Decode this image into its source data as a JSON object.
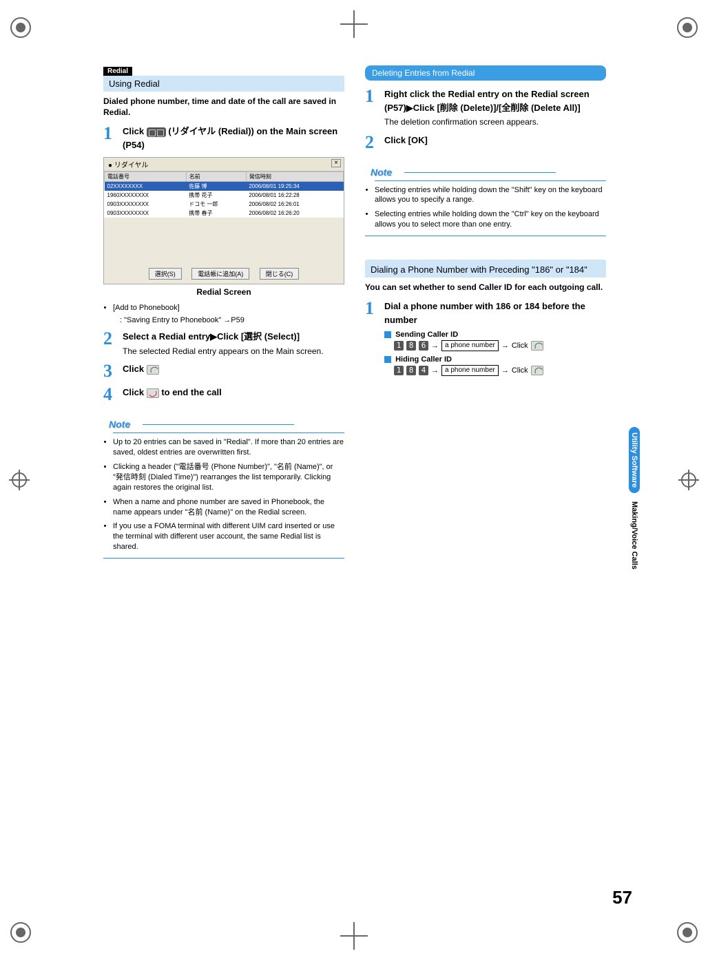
{
  "page_number": "57",
  "side_tab": {
    "blue": "Utility Software",
    "black": "Making/Voice Calls"
  },
  "left": {
    "tag": "Redial",
    "heading": "Using Redial",
    "intro": "Dialed phone number, time and date of the call are saved in Redial.",
    "step1": {
      "pre": "Click ",
      "post": " (リダイヤル (Redial)) on the Main screen (P54)"
    },
    "screenshot": {
      "title": "リダイヤル",
      "headers": [
        "電話番号",
        "名前",
        "発信時刻"
      ],
      "rows": [
        [
          "02XXXXXXXX",
          "佐藤 博",
          "2006/08/01 19:25:34"
        ],
        [
          "1960XXXXXXXX",
          "携帯 花子",
          "2006/08/01 16:22:28"
        ],
        [
          "0903XXXXXXXX",
          "ドコモ 一郎",
          "2006/08/02 16:26:01"
        ],
        [
          "0903XXXXXXXX",
          "携帯 春子",
          "2006/08/02 16:26:20"
        ]
      ],
      "buttons": [
        "選択(S)",
        "電話帳に追加(A)",
        "閉じる(C)"
      ]
    },
    "caption": "Redial Screen",
    "add_label": "[Add to Phonebook]",
    "add_ref": ":   \"Saving Entry to Phonebook\" →P59",
    "step2": {
      "title": "Select a Redial entry▶Click [選択 (Select)]",
      "desc": "The selected Redial entry appears on the Main screen."
    },
    "step3": {
      "pre": "Click "
    },
    "step4": {
      "pre": "Click ",
      "post": " to end the call"
    },
    "note_label": "Note",
    "notes": [
      "Up to 20 entries can be saved in \"Redial\". If more than 20 entries are saved, oldest entries are overwritten first.",
      "Clicking a header (\"電話番号 (Phone Number)\", \"名前 (Name)\", or \"発信時刻 (Dialed Time)\") rearranges the list temporarily. Clicking again restores the original list.",
      "When a name and phone number are saved in Phonebook, the name appears under \"名前 (Name)\" on the Redial screen.",
      "If you use a FOMA terminal with different UIM card inserted or use the terminal with different user account, the same Redial list is shared."
    ]
  },
  "right": {
    "subheading1": "Deleting Entries from Redial",
    "del_step1": {
      "title": "Right click the Redial entry on the Redial screen (P57)▶Click [削除 (Delete)]/[全削除 (Delete All)]",
      "desc": "The deletion confirmation screen appears."
    },
    "del_step2": {
      "title": "Click [OK]"
    },
    "note_label": "Note",
    "del_notes": [
      "Selecting entries while holding down the \"Shift\" key on the keyboard allows you to specify a range.",
      "Selecting entries while holding down the \"Ctrl\" key on the keyboard allows you to select more than one entry."
    ],
    "heading2": "Dialing a Phone Number with Preceding \"186\" or \"184\"",
    "intro2": "You can set whether to send Caller ID for each outgoing call.",
    "dial_step1": {
      "title": "Dial a phone number with 186 or 184 before the number"
    },
    "send_label": "Sending Caller ID",
    "hide_label": "Hiding Caller ID",
    "prefix_send": [
      "1",
      "8",
      "6"
    ],
    "prefix_hide": [
      "1",
      "8",
      "4"
    ],
    "phone_box": "a phone number",
    "arrow": "→",
    "click": "Click"
  }
}
